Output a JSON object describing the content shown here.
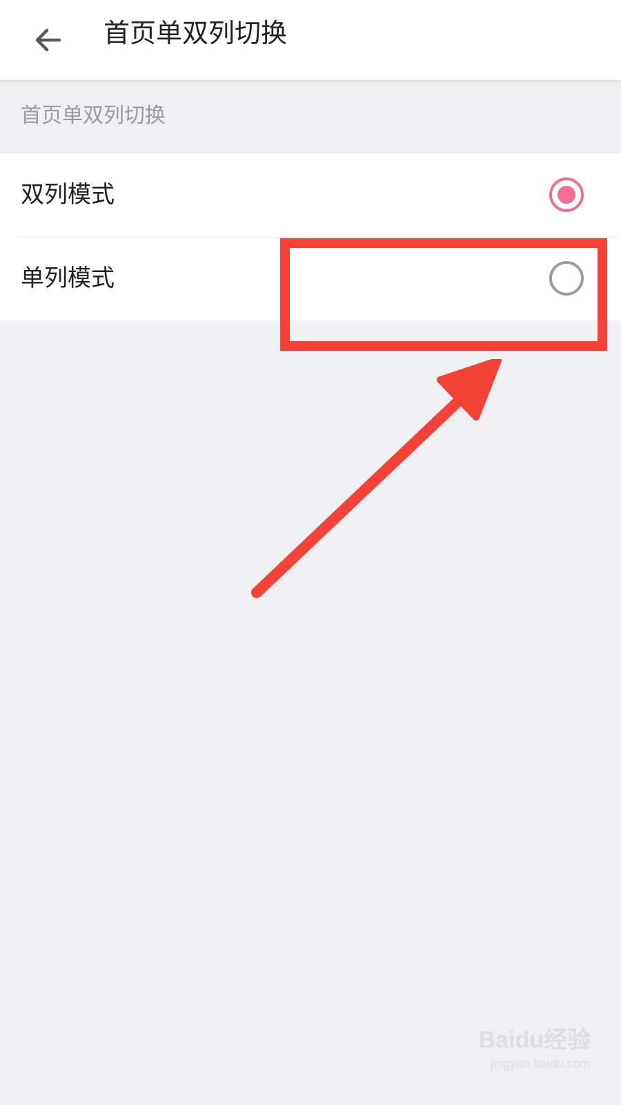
{
  "header": {
    "back_icon": "arrow-left-icon",
    "title": "首页单双列切换"
  },
  "section": {
    "title": "首页单双列切换"
  },
  "options": [
    {
      "label": "双列模式",
      "selected": true
    },
    {
      "label": "单列模式",
      "selected": false
    }
  ],
  "colors": {
    "accent": "#f06e94",
    "radio_off": "#9b9b9b",
    "annotation": "#f44336",
    "background": "#f0f0f3"
  },
  "watermark": {
    "brand": "Baidu经验",
    "url": "jingyan.baidu.com"
  }
}
